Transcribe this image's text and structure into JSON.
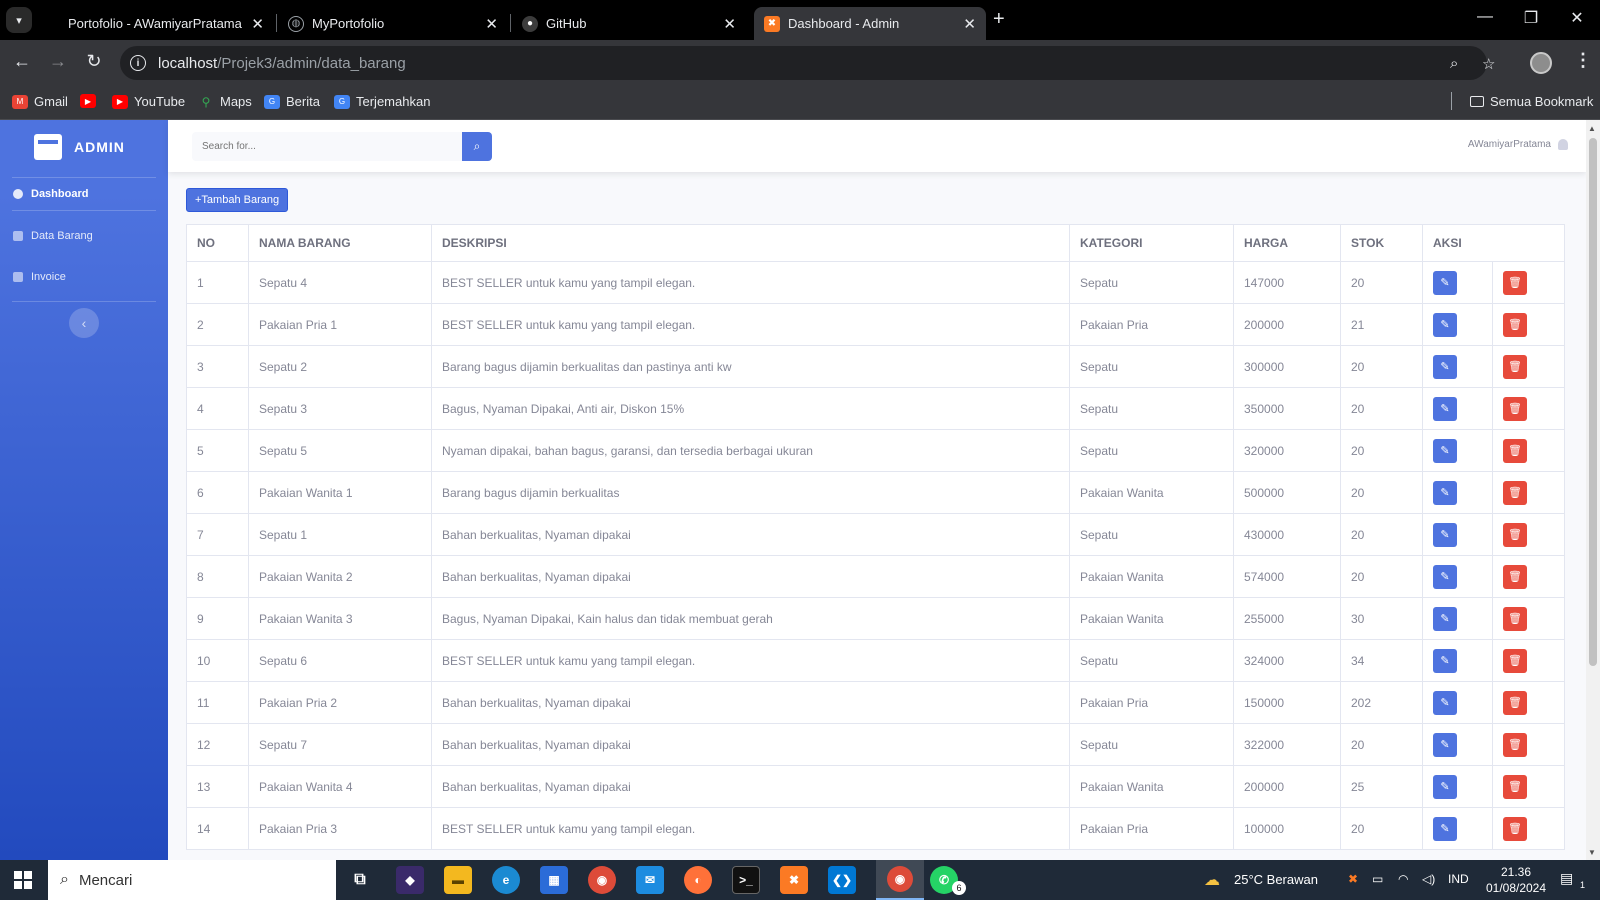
{
  "browser": {
    "tabs": [
      {
        "title": "Portofolio - AWamiyarPratama",
        "active": false
      },
      {
        "title": "MyPortofolio",
        "active": false
      },
      {
        "title": "GitHub",
        "active": false
      },
      {
        "title": "Dashboard - Admin",
        "active": true
      }
    ],
    "url_host": "localhost",
    "url_path": "/Projek3/admin/data_barang",
    "bookmarks": [
      "Gmail",
      "YouTube",
      "Maps",
      "Berita",
      "Terjemahkan"
    ],
    "all_bookmarks": "Semua Bookmark"
  },
  "sidebar": {
    "brand": "ADMIN",
    "items": [
      {
        "label": "Dashboard",
        "icon": "dashboard-icon"
      },
      {
        "label": "Data Barang",
        "icon": "database-icon"
      },
      {
        "label": "Invoice",
        "icon": "file-icon"
      }
    ]
  },
  "topbar": {
    "search_placeholder": "Search for...",
    "username": "AWamiyarPratama"
  },
  "content": {
    "add_button": "+Tambah Barang",
    "columns": [
      "NO",
      "NAMA BARANG",
      "DESKRIPSI",
      "KATEGORI",
      "HARGA",
      "STOK",
      "AKSI"
    ],
    "rows": [
      {
        "no": "1",
        "nama": "Sepatu 4",
        "deskripsi": "BEST SELLER untuk kamu yang tampil elegan.",
        "kategori": "Sepatu",
        "harga": "147000",
        "stok": "20"
      },
      {
        "no": "2",
        "nama": "Pakaian Pria 1",
        "deskripsi": "BEST SELLER untuk kamu yang tampil elegan.",
        "kategori": "Pakaian Pria",
        "harga": "200000",
        "stok": "21"
      },
      {
        "no": "3",
        "nama": "Sepatu 2",
        "deskripsi": "Barang bagus dijamin berkualitas dan pastinya anti kw",
        "kategori": "Sepatu",
        "harga": "300000",
        "stok": "20"
      },
      {
        "no": "4",
        "nama": "Sepatu 3",
        "deskripsi": "Bagus, Nyaman Dipakai, Anti air, Diskon 15%",
        "kategori": "Sepatu",
        "harga": "350000",
        "stok": "20"
      },
      {
        "no": "5",
        "nama": "Sepatu 5",
        "deskripsi": "Nyaman dipakai, bahan bagus, garansi, dan tersedia berbagai ukuran",
        "kategori": "Sepatu",
        "harga": "320000",
        "stok": "20"
      },
      {
        "no": "6",
        "nama": "Pakaian Wanita 1",
        "deskripsi": "Barang bagus dijamin berkualitas",
        "kategori": "Pakaian Wanita",
        "harga": "500000",
        "stok": "20"
      },
      {
        "no": "7",
        "nama": "Sepatu 1",
        "deskripsi": "Bahan berkualitas, Nyaman dipakai",
        "kategori": "Sepatu",
        "harga": "430000",
        "stok": "20"
      },
      {
        "no": "8",
        "nama": "Pakaian Wanita 2",
        "deskripsi": "Bahan berkualitas, Nyaman dipakai",
        "kategori": "Pakaian Wanita",
        "harga": "574000",
        "stok": "20"
      },
      {
        "no": "9",
        "nama": "Pakaian Wanita 3",
        "deskripsi": "Bagus, Nyaman Dipakai, Kain halus dan tidak membuat gerah",
        "kategori": "Pakaian Wanita",
        "harga": "255000",
        "stok": "30"
      },
      {
        "no": "10",
        "nama": "Sepatu 6",
        "deskripsi": "BEST SELLER untuk kamu yang tampil elegan.",
        "kategori": "Sepatu",
        "harga": "324000",
        "stok": "34"
      },
      {
        "no": "11",
        "nama": "Pakaian Pria 2",
        "deskripsi": "Bahan berkualitas, Nyaman dipakai",
        "kategori": "Pakaian Pria",
        "harga": "150000",
        "stok": "202"
      },
      {
        "no": "12",
        "nama": "Sepatu 7",
        "deskripsi": "Bahan berkualitas, Nyaman dipakai",
        "kategori": "Sepatu",
        "harga": "322000",
        "stok": "20"
      },
      {
        "no": "13",
        "nama": "Pakaian Wanita 4",
        "deskripsi": "Bahan berkualitas, Nyaman dipakai",
        "kategori": "Pakaian Wanita",
        "harga": "200000",
        "stok": "25"
      },
      {
        "no": "14",
        "nama": "Pakaian Pria 3",
        "deskripsi": "BEST SELLER untuk kamu yang tampil elegan.",
        "kategori": "Pakaian Pria",
        "harga": "100000",
        "stok": "20"
      }
    ]
  },
  "taskbar": {
    "search_placeholder": "Mencari",
    "weather": "25°C  Berawan",
    "language": "IND",
    "time": "21.36",
    "date": "01/08/2024",
    "whatsapp_badge": "6",
    "notification_count": "1"
  },
  "colors": {
    "primary": "#4e73df",
    "danger": "#e74a3b",
    "sidebar_gradient_end": "#224abe"
  }
}
